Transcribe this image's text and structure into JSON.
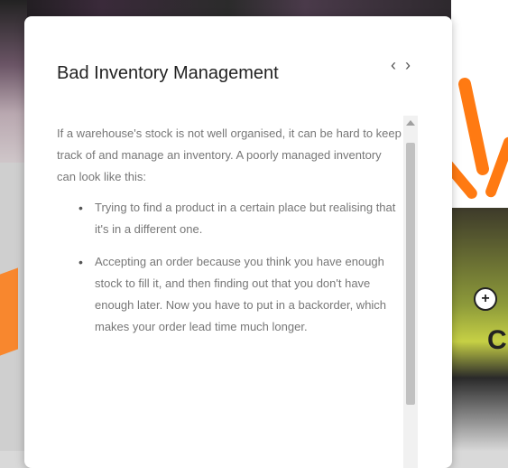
{
  "card": {
    "title": "Bad Inventory Management",
    "nav_prev": "‹",
    "nav_next": "›",
    "paragraph": "If a warehouse's stock is not well organised, it can be hard to keep track of and manage an inventory. A poorly managed inventory can look like this:",
    "bullets": [
      "Trying to find a product in a certain place but realising that it's in a different one.",
      "Accepting an order because you think you have enough stock to fill it, and then finding out that you don't have enough later. Now you have to put in a backorder, which makes your order lead time much longer."
    ]
  },
  "background": {
    "plus_label": "+",
    "partial_heading": "C"
  },
  "colors": {
    "accent_orange": "#ff7a12",
    "card_bg": "#ffffff",
    "text": "#777777"
  }
}
